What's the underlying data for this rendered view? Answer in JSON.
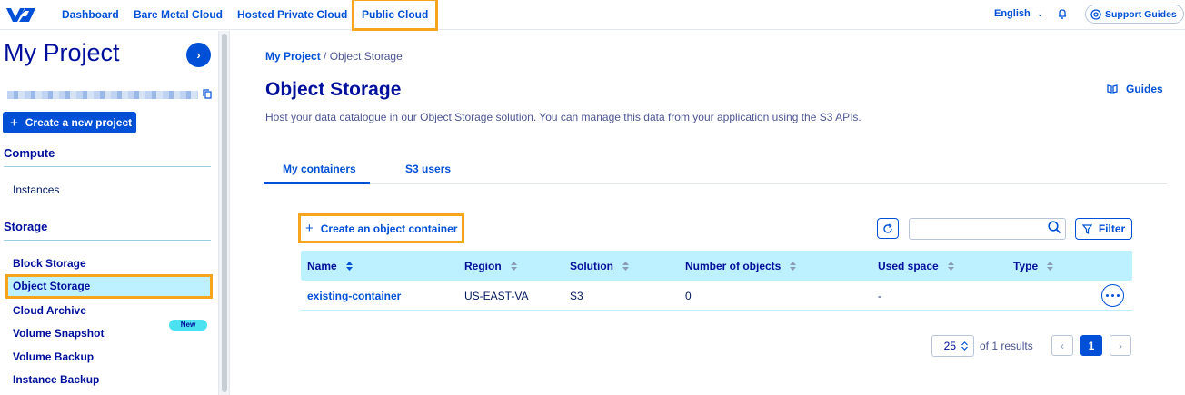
{
  "colors": {
    "primary": "#0050d7",
    "navy": "#000e9c",
    "highlight": "#f7a51c",
    "table_header": "#bef1ff",
    "badge": "#4be1f0"
  },
  "topnav": {
    "logo": "ovh-logo-icon",
    "links": [
      "Dashboard",
      "Bare Metal Cloud",
      "Hosted Private Cloud",
      "Public Cloud"
    ],
    "active": "Public Cloud",
    "language": "English",
    "support_label": "Support Guides"
  },
  "sidebar": {
    "project_title": "My Project",
    "create_label": "Create a new project",
    "sections": [
      {
        "heading": "Compute",
        "items": [
          "Instances"
        ]
      },
      {
        "heading": "Storage",
        "items": [
          "Block Storage",
          "Object Storage",
          "Cloud Archive",
          "Volume Snapshot",
          "Volume Backup",
          "Instance Backup"
        ]
      }
    ],
    "active_item": "Object Storage",
    "new_badge": "New"
  },
  "breadcrumb": {
    "parent": "My Project",
    "separator": "/",
    "current": "Object Storage"
  },
  "page": {
    "title": "Object Storage",
    "guides_label": "Guides",
    "description": "Host your data catalogue in our Object Storage solution. You can manage this data from your application using the S3 APIs."
  },
  "tabs": [
    {
      "label": "My containers",
      "active": true
    },
    {
      "label": "S3 users",
      "active": false
    }
  ],
  "toolbar": {
    "create_label": "Create an object container",
    "search_value": "",
    "filter_label": "Filter"
  },
  "table": {
    "columns": [
      "Name",
      "Region",
      "Solution",
      "Number of objects",
      "Used space",
      "Type"
    ],
    "rows": [
      {
        "name": "existing-container",
        "region": "US-EAST-VA",
        "solution": "S3",
        "objects": "0",
        "used_space": "-",
        "type": ""
      }
    ]
  },
  "pagination": {
    "page_size": "25",
    "results_text": "of 1 results",
    "current_page": "1"
  }
}
